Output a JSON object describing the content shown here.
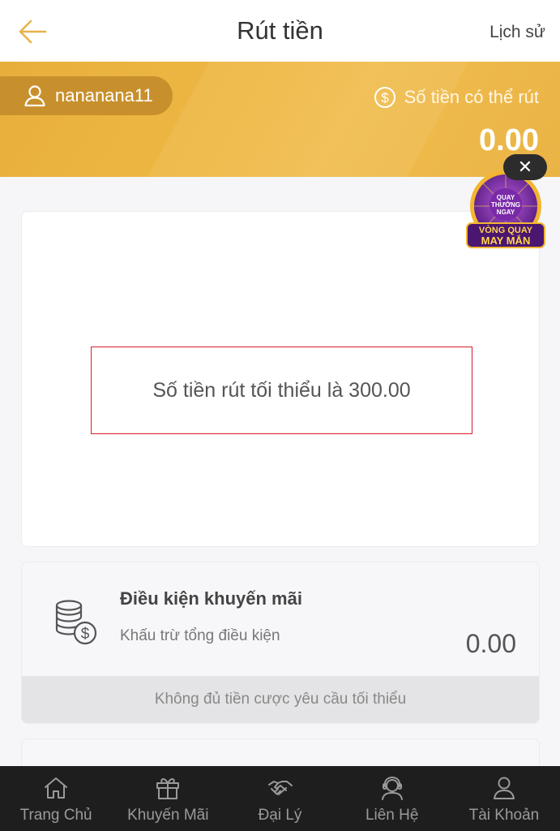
{
  "header": {
    "title": "Rút tiền",
    "history_label": "Lịch sử",
    "back_icon": "back-arrow-icon"
  },
  "banner": {
    "username": "nananana11",
    "withdrawable_label": "Số tiền có thể rút",
    "withdrawable_amount": "0.00"
  },
  "main": {
    "min_withdraw_text": "Số tiền rút tối thiểu là 300.00"
  },
  "promo": {
    "title": "Điều kiện khuyến mãi",
    "subtitle": "Khấu trừ tổng điều kiện",
    "amount": "0.00",
    "footer": "Không đủ tiền cược yêu cầu tối thiểu"
  },
  "widget": {
    "line1": "QUAY",
    "line2": "THƯỞNG",
    "line3": "NGAY",
    "line4": "VÒNG QUAY",
    "line5": "MAY MẮN",
    "close_symbol": "✕"
  },
  "nav": [
    {
      "label": "Trang Chủ",
      "icon": "home-icon"
    },
    {
      "label": "Khuyến Mãi",
      "icon": "gift-icon"
    },
    {
      "label": "Đại Lý",
      "icon": "handshake-icon"
    },
    {
      "label": "Liên Hệ",
      "icon": "support-icon"
    },
    {
      "label": "Tài Khoản",
      "icon": "user-icon"
    }
  ],
  "colors": {
    "accent": "#eeb843",
    "banner_dark": "#c8902c",
    "error_border": "#d81e2a",
    "nav_bg": "#1e1e1e"
  }
}
